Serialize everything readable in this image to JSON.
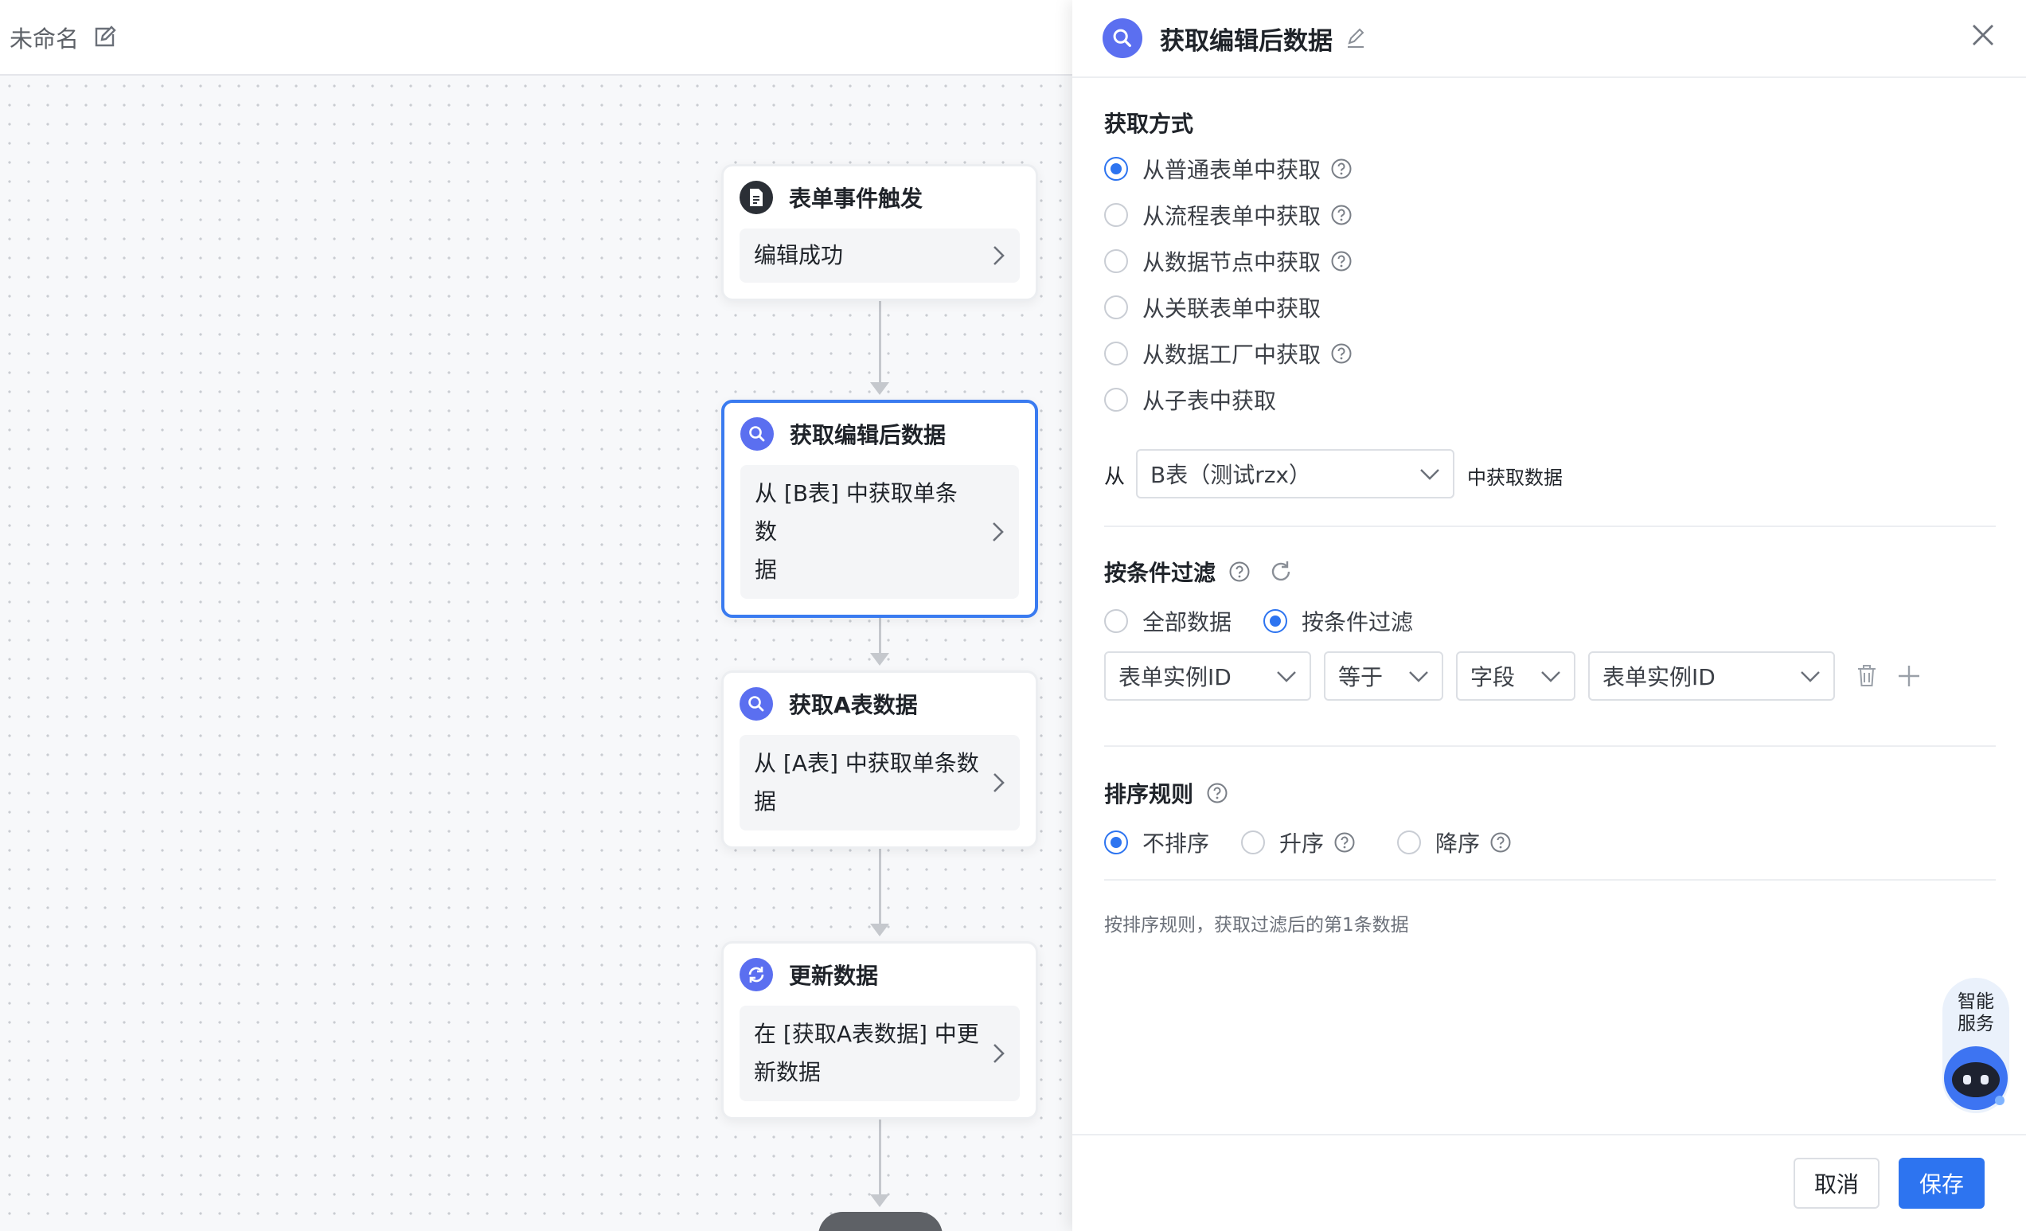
{
  "canvas": {
    "title": "未命名",
    "nodes": [
      {
        "title": "表单事件触发",
        "body": "编辑成功",
        "icon": "form-doc-icon"
      },
      {
        "title": "获取编辑后数据",
        "body_line1": "从 [B表] 中获取单条数",
        "body_line2": "据",
        "icon": "search-icon"
      },
      {
        "title": "获取A表数据",
        "body_line1": "从 [A表] 中获取单条数",
        "body_line2": "据",
        "icon": "search-icon"
      },
      {
        "title": "更新数据",
        "body_line1": "在 [获取A表数据] 中更",
        "body_line2": "新数据",
        "icon": "refresh-icon"
      }
    ]
  },
  "panel": {
    "title": "获取编辑后数据",
    "fetch_mode": {
      "label": "获取方式",
      "options": [
        "从普通表单中获取",
        "从流程表单中获取",
        "从数据节点中获取",
        "从关联表单中获取",
        "从数据工厂中获取",
        "从子表中获取"
      ],
      "selected": "从普通表单中获取"
    },
    "source": {
      "prefix": "从",
      "table": "B表（测试rzx）",
      "suffix": "中获取数据"
    },
    "filter": {
      "label": "按条件过滤",
      "options": [
        "全部数据",
        "按条件过滤"
      ],
      "selected": "按条件过滤",
      "condition": {
        "field": "表单实例ID",
        "operator": "等于",
        "value_type": "字段",
        "value": "表单实例ID"
      }
    },
    "sort": {
      "label": "排序规则",
      "options": [
        "不排序",
        "升序",
        "降序"
      ],
      "selected": "不排序",
      "hint": "按排序规则，获取过滤后的第1条数据"
    },
    "buttons": {
      "cancel": "取消",
      "save": "保存"
    }
  },
  "ai_widget": {
    "line1": "智能",
    "line2": "服务"
  },
  "colors": {
    "accent": "#2d74f0",
    "node_icon": "#5b6ff0"
  }
}
